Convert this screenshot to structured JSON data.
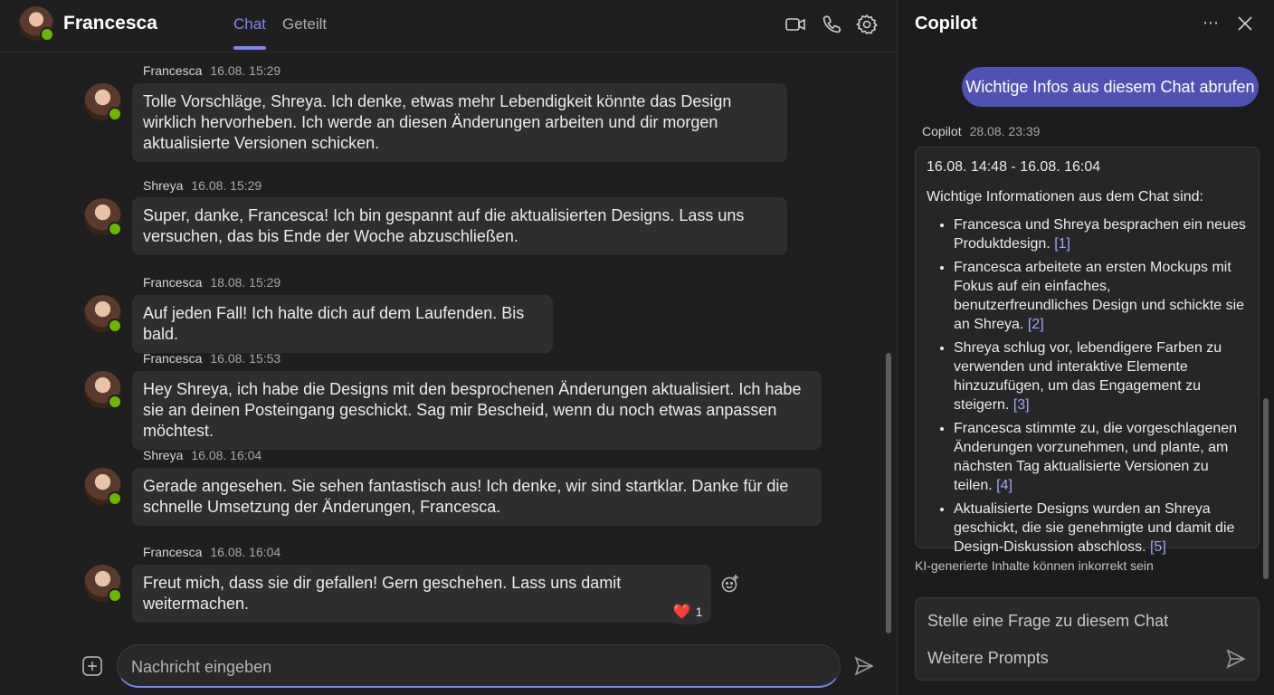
{
  "chat": {
    "contact_name": "Francesca",
    "tabs": [
      {
        "label": "Chat",
        "active": true
      },
      {
        "label": "Geteilt",
        "active": false
      }
    ],
    "header_icons": [
      "video-call-icon",
      "phone-call-icon",
      "settings-icon"
    ],
    "messages": [
      {
        "sender": "Francesca",
        "time": "16.08. 15:29",
        "text": "Tolle Vorschläge, Shreya. Ich denke, etwas mehr Lebendigkeit könnte das Design wirklich hervorheben. Ich werde an diesen Änderungen arbeiten und dir morgen aktualisierte Versionen schicken."
      },
      {
        "sender": "Shreya",
        "time": "16.08. 15:29",
        "text": "Super, danke, Francesca! Ich bin gespannt auf die aktualisierten Designs. Lass uns versuchen, das bis Ende der Woche abzuschließen."
      },
      {
        "sender": "Francesca",
        "time": "18.08. 15:29",
        "text": "Auf jeden Fall! Ich halte dich auf dem Laufenden. Bis bald."
      },
      {
        "sender": "Francesca",
        "time": "16.08. 15:53",
        "text": "Hey Shreya, ich habe die Designs mit den besprochenen Änderungen aktualisiert. Ich habe sie an deinen Posteingang geschickt. Sag mir Bescheid, wenn du noch etwas anpassen möchtest."
      },
      {
        "sender": "Shreya",
        "time": "16.08. 16:04",
        "text": "Gerade angesehen. Sie sehen fantastisch aus! Ich denke, wir sind startklar. Danke für die schnelle Umsetzung der Änderungen, Francesca."
      },
      {
        "sender": "Francesca",
        "time": "16.08. 16:04",
        "text": "Freut mich, dass sie dir gefallen! Gern geschehen. Lass uns damit weitermachen."
      }
    ],
    "reaction": {
      "emoji": "❤️",
      "count": "1"
    },
    "compose_placeholder": "Nachricht eingeben"
  },
  "copilot": {
    "title": "Copilot",
    "user_prompt": "Wichtige Infos aus diesem Chat abrufen",
    "response_sender": "Copilot",
    "response_time": "28.08. 23:39",
    "range": "16.08. 14:48 - 16.08. 16:04",
    "intro": "Wichtige Informationen aus dem Chat sind:",
    "points": [
      {
        "text": "Francesca und Shreya besprachen ein neues Produktdesign.",
        "ref": "[1]"
      },
      {
        "text": "Francesca arbeitete an ersten Mockups mit Fokus auf ein einfaches, benutzerfreundliches Design und schickte sie an Shreya.",
        "ref": "[2]"
      },
      {
        "text": "Shreya schlug vor, lebendigere Farben zu verwenden und interaktive Elemente hinzuzufügen, um das Engagement zu steigern.",
        "ref": "[3]"
      },
      {
        "text": "Francesca stimmte zu, die vorgeschlagenen Änderungen vorzunehmen, und plante, am nächsten Tag aktualisierte Versionen zu teilen.",
        "ref": "[4]"
      },
      {
        "text": "Aktualisierte Designs wurden an Shreya geschickt, die sie genehmigte und damit die Design-Diskussion abschloss.",
        "ref": "[5]"
      }
    ],
    "disclaimer": "KI-generierte Inhalte können inkorrekt sein",
    "input_placeholder": "Stelle eine Frage zu diesem Chat",
    "more_prompts": "Weitere Prompts"
  },
  "colors": {
    "accent": "#7f85f5",
    "prompt_bubble": "#4f52b2",
    "presence_available": "#6bb700"
  }
}
